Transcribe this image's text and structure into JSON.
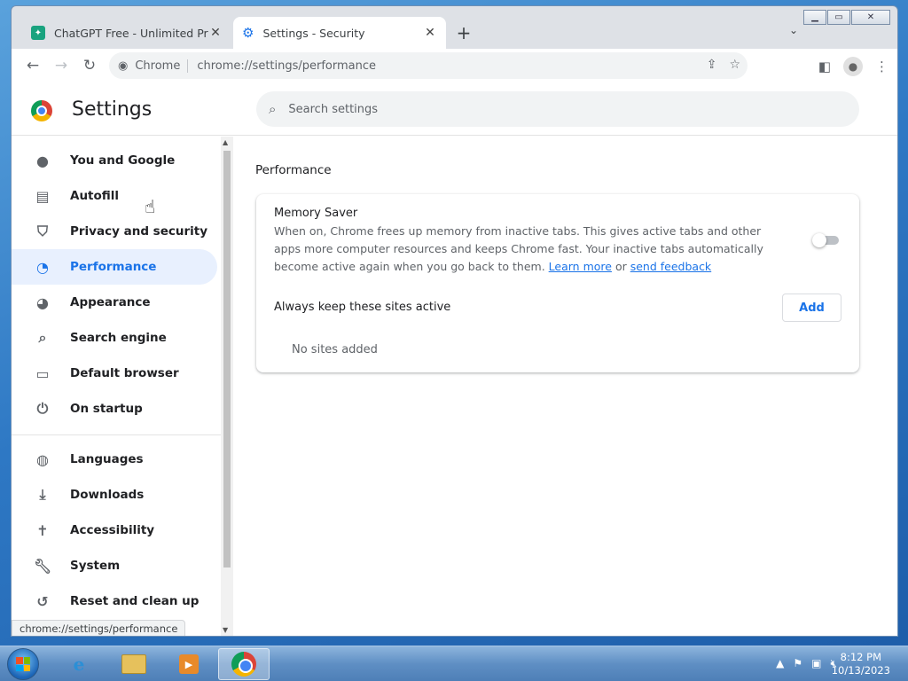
{
  "browser": {
    "tabs": [
      {
        "title": "ChatGPT Free - Unlimited Promp",
        "active": false
      },
      {
        "title": "Settings - Security",
        "active": true
      }
    ],
    "omnibox": {
      "scheme_label": "Chrome",
      "url": "chrome://settings/performance"
    }
  },
  "settings": {
    "title": "Settings",
    "search_placeholder": "Search settings",
    "sidebar": {
      "items": [
        {
          "label": "You and Google",
          "icon": "person-icon"
        },
        {
          "label": "Autofill",
          "icon": "clipboard-icon"
        },
        {
          "label": "Privacy and security",
          "icon": "shield-icon"
        },
        {
          "label": "Performance",
          "icon": "speedometer-icon",
          "selected": true
        },
        {
          "label": "Appearance",
          "icon": "palette-icon"
        },
        {
          "label": "Search engine",
          "icon": "search-icon"
        },
        {
          "label": "Default browser",
          "icon": "browser-icon"
        },
        {
          "label": "On startup",
          "icon": "power-icon"
        },
        {
          "label": "Languages",
          "icon": "globe-icon"
        },
        {
          "label": "Downloads",
          "icon": "download-icon"
        },
        {
          "label": "Accessibility",
          "icon": "accessibility-icon"
        },
        {
          "label": "System",
          "icon": "wrench-icon"
        },
        {
          "label": "Reset and clean up",
          "icon": "history-icon"
        }
      ]
    },
    "status_tip": "chrome://settings/performance",
    "main": {
      "heading": "Performance",
      "memory_saver": {
        "title": "Memory Saver",
        "description": "When on, Chrome frees up memory from inactive tabs. This gives active tabs and other apps more computer resources and keeps Chrome fast. Your inactive tabs automatically become active again when you go back to them.",
        "learn_more": "Learn more",
        "or": "or",
        "send_feedback": "send feedback",
        "enabled": false
      },
      "keep_active": {
        "label": "Always keep these sites active",
        "add_button": "Add",
        "empty_text": "No sites added"
      }
    }
  },
  "taskbar": {
    "clock_time": "8:12 PM",
    "clock_date": "10/13/2023"
  },
  "colors": {
    "accent": "#1a73e8",
    "selected_bg": "#e8f0fe"
  }
}
